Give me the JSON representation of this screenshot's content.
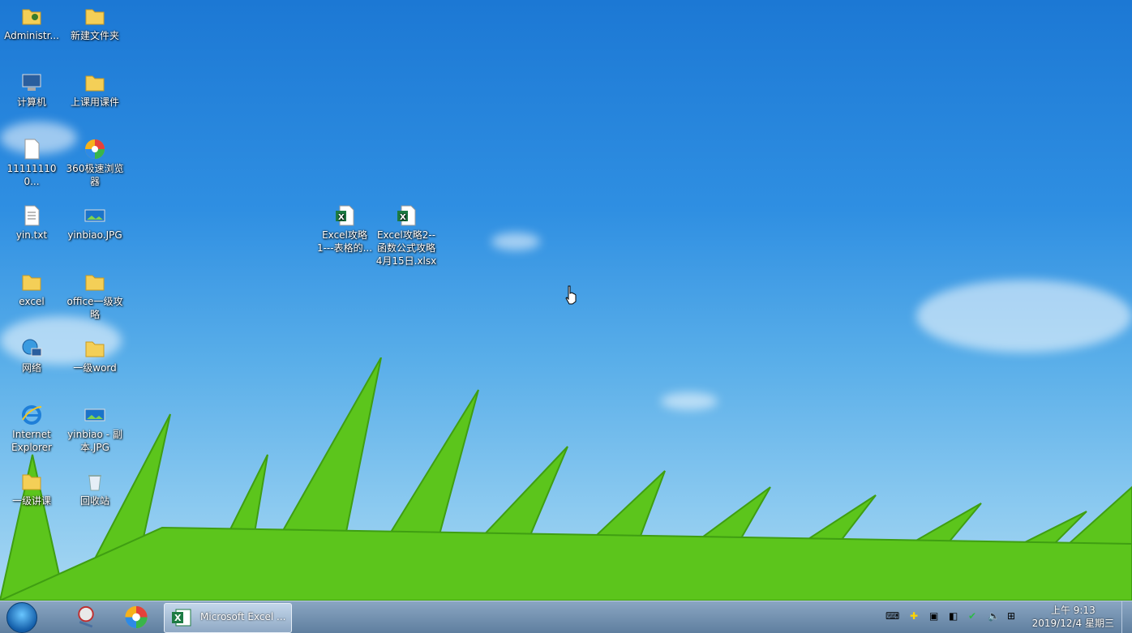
{
  "desktop_icons": [
    {
      "label": "Administr...",
      "icon": "user-folder-icon"
    },
    {
      "label": "新建文件夹",
      "icon": "folder-icon"
    },
    {
      "label": "计算机",
      "icon": "computer-icon"
    },
    {
      "label": "上课用课件",
      "icon": "folder-icon"
    },
    {
      "label": "111111100...",
      "icon": "file-icon"
    },
    {
      "label": "360极速浏览\n器",
      "icon": "360-browser-icon"
    },
    {
      "label": "yin.txt",
      "icon": "text-file-icon"
    },
    {
      "label": "yinbiao.JPG",
      "icon": "image-file-icon"
    },
    {
      "label": "excel",
      "icon": "folder-icon"
    },
    {
      "label": "office一级攻\n略",
      "icon": "folder-icon"
    },
    {
      "label": "网络",
      "icon": "network-icon"
    },
    {
      "label": "一级word",
      "icon": "folder-icon"
    },
    {
      "label": "Internet\nExplorer",
      "icon": "internet-explorer-icon"
    },
    {
      "label": "yinbiao - 副\n本.JPG",
      "icon": "image-file-icon"
    },
    {
      "label": "一级讲课",
      "icon": "folder-icon"
    },
    {
      "label": "回收站",
      "icon": "recycle-bin-icon"
    },
    {
      "label": "Excel攻略\n1---表格的...",
      "icon": "excel-file-icon"
    },
    {
      "label": "Excel攻略2--\n函数公式攻略\n4月15日.xlsx",
      "icon": "excel-file-icon"
    }
  ],
  "taskbar": {
    "excel_task_label": "Microsoft Excel ...",
    "clock_time": "上午 9:13",
    "clock_date": "2019/12/4 星期三"
  },
  "colors": {
    "sky": "#2f8fe2",
    "grass": "#5cc51c",
    "taskbar": "#6f8faf"
  }
}
